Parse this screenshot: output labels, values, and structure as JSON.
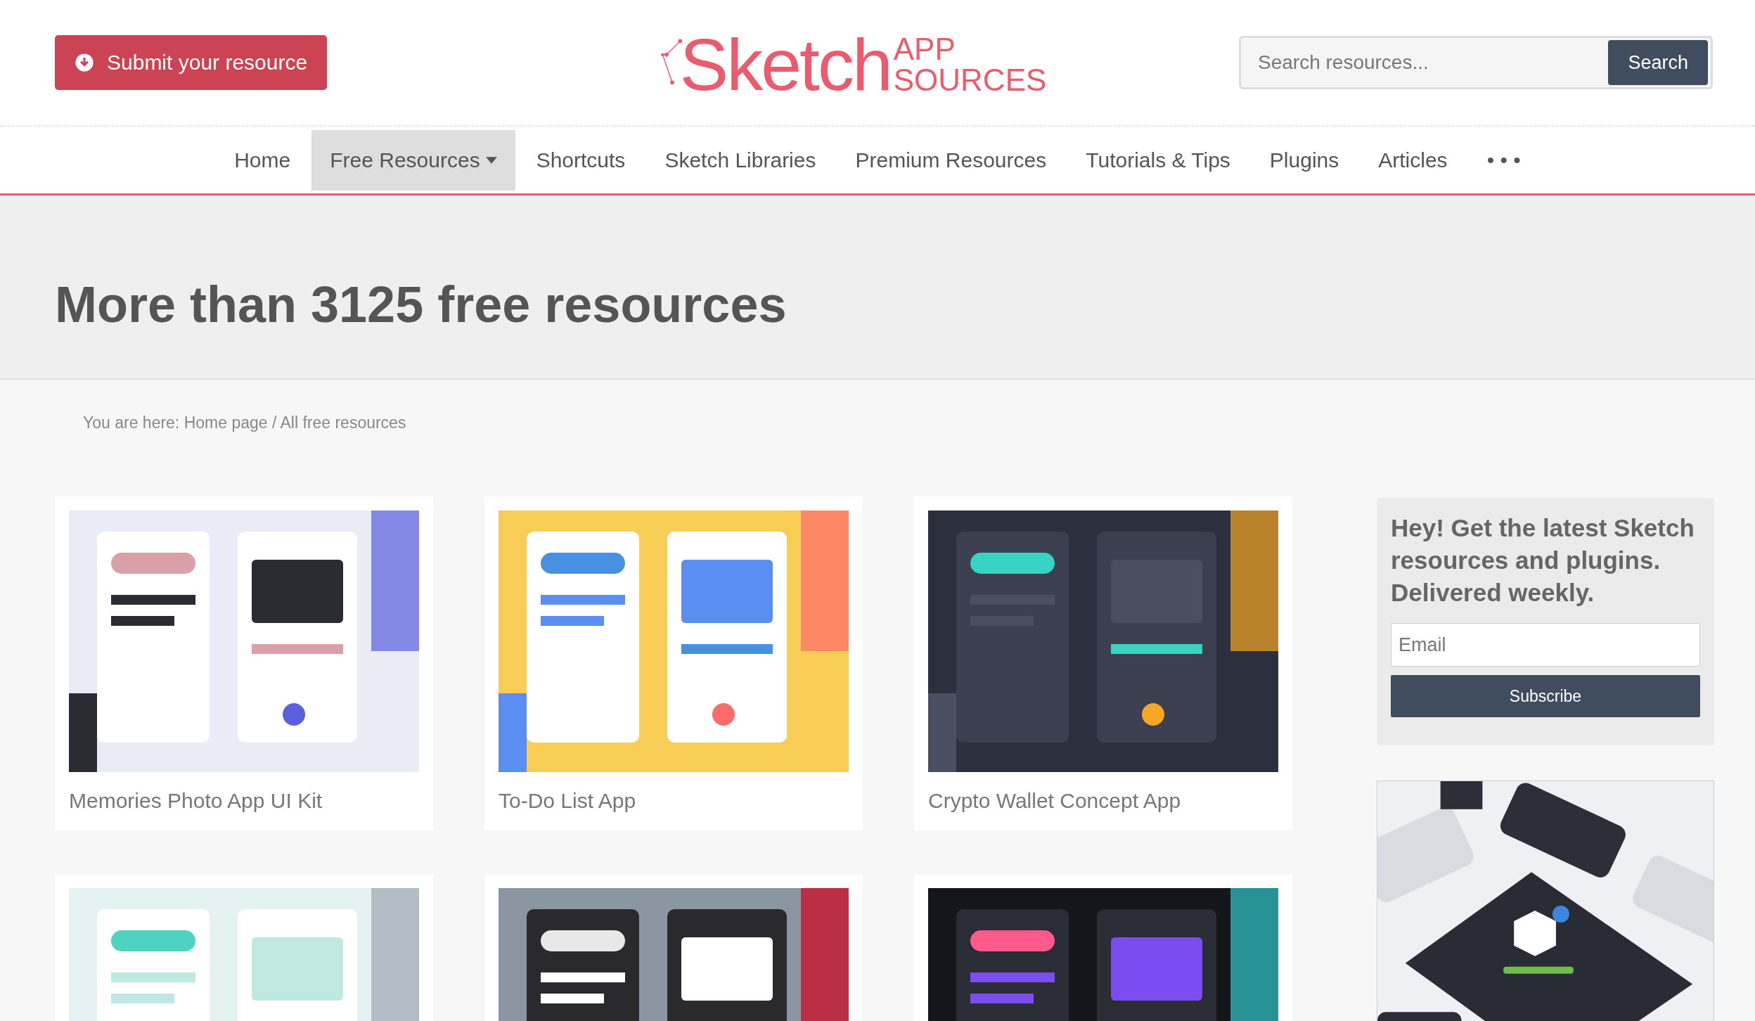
{
  "header": {
    "submit_button": "Submit your resource",
    "logo": {
      "main": "Sketch",
      "top": "APP",
      "bottom": "SOURCES"
    },
    "search": {
      "placeholder": "Search resources...",
      "button": "Search"
    }
  },
  "nav": [
    {
      "label": "Home",
      "selected": false,
      "dropdown": false
    },
    {
      "label": "Free Resources",
      "selected": true,
      "dropdown": true
    },
    {
      "label": "Shortcuts",
      "selected": false,
      "dropdown": false
    },
    {
      "label": "Sketch Libraries",
      "selected": false,
      "dropdown": false
    },
    {
      "label": "Premium Resources",
      "selected": false,
      "dropdown": false
    },
    {
      "label": "Tutorials & Tips",
      "selected": false,
      "dropdown": false
    },
    {
      "label": "Plugins",
      "selected": false,
      "dropdown": false
    },
    {
      "label": "Articles",
      "selected": false,
      "dropdown": false
    },
    {
      "label": "• • •",
      "selected": false,
      "dropdown": false
    }
  ],
  "hero": {
    "title": "More than 3125 free resources"
  },
  "breadcrumb": "You are here: Home page / All free resources",
  "cards": [
    {
      "title": "Memories Photo App UI Kit",
      "kind": "picture"
    },
    {
      "title": "To-Do List App",
      "kind": "picture"
    },
    {
      "title": "Crypto Wallet Concept App",
      "kind": "picture"
    },
    {
      "kind": "picture"
    },
    {
      "kind": "picture"
    },
    {
      "kind": "picture"
    }
  ],
  "sidebar": {
    "newsletter": {
      "heading": "Hey! Get the latest Sketch resources and plugins. Delivered weekly.",
      "placeholder": "Email",
      "button": "Subscribe"
    },
    "ad": {
      "kind": "picture"
    }
  }
}
